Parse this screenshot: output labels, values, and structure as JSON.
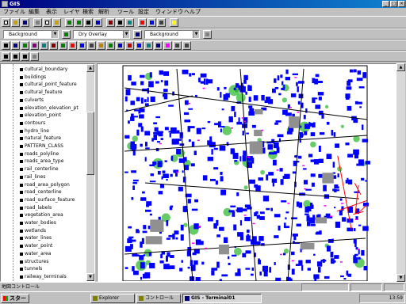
{
  "window": {
    "title": "GIS"
  },
  "menubar": {
    "items": [
      "ファイル",
      "編集",
      "表示",
      "レイヤ",
      "検索",
      "解析",
      "ツール",
      "設定",
      "ウィンドウ",
      "ヘルプ"
    ]
  },
  "toolbar2": {
    "combo1": "Background",
    "combo2": "Dry Overlay",
    "combo3": "Background"
  },
  "layers": {
    "items": [
      "cultural_boundary",
      "buildings",
      "cultural_point_feature",
      "cultural_feature",
      "culverts",
      "elevation_elevation_pt",
      "elevation_point",
      "contours",
      "hydro_line",
      "natural_feature",
      "PATTERN_CLASS",
      "roads_polyline",
      "roads_area_type",
      "rail_centerline",
      "rail_lines",
      "road_area_polygon",
      "road_centerline",
      "road_surface_feature",
      "road_labels",
      "vegetation_area",
      "water_bodies",
      "wetlands",
      "water_lines",
      "water_point",
      "water_area",
      "structures",
      "tunnels",
      "railway_terminals"
    ]
  },
  "statusbar": {
    "text": "地図コントロール"
  },
  "taskbar": {
    "start_label": "スタート",
    "tasks": [
      "Explorer",
      "コントロール",
      "GIS - Terminal01"
    ],
    "tray_time": "13:59"
  },
  "colors": {
    "building": "#0000ff",
    "road": "#000000",
    "vegetation": "#00aa00",
    "label": "#ff00ff",
    "highlight": "#ff0000"
  }
}
